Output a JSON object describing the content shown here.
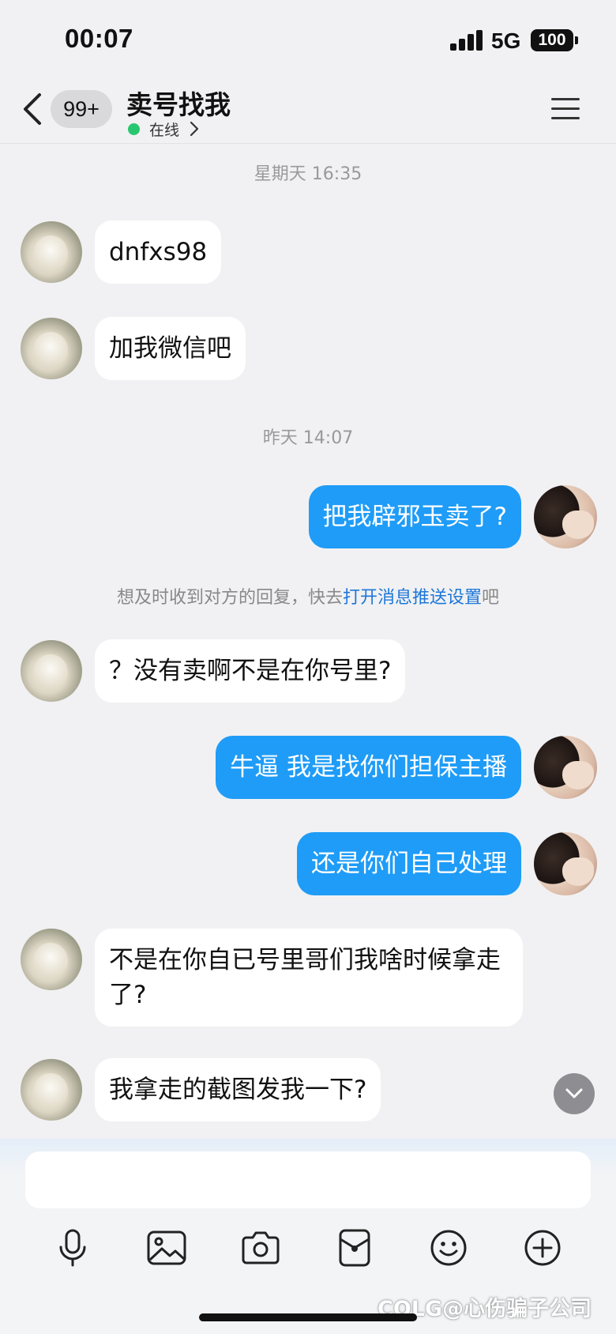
{
  "status_bar": {
    "time": "00:07",
    "network": "5G",
    "battery": "100"
  },
  "header": {
    "unread_badge": "99+",
    "title": "卖号找我",
    "status": "在线"
  },
  "messages": {
    "timestamp_1": "星期天 16:35",
    "m1": "dnfxs98",
    "m2": "加我微信吧",
    "timestamp_2": "昨天 14:07",
    "m3": "把我辟邪玉卖了?",
    "notice_prefix": "想及时收到对方的回复，快去",
    "notice_link": "打开消息推送设置",
    "notice_suffix": "吧",
    "m4": "？没有卖啊不是在你号里?",
    "m5": "牛逼 我是找你们担保主播",
    "m6": "还是你们自己处理",
    "m7": "不是在你自已号里哥们我啥时候拿走了?",
    "m8": "我拿走的截图发我一下?"
  },
  "input": {
    "placeholder": ""
  },
  "toolbar_icons": [
    "microphone-icon",
    "image-icon",
    "camera-icon",
    "red-packet-icon",
    "emoji-icon",
    "plus-icon"
  ],
  "watermark": "COLG@心伤骗子公司",
  "colors": {
    "outgoing_bubble": "#1f9cf7",
    "incoming_bubble": "#ffffff",
    "online": "#28c76f",
    "link": "#1d77d8"
  }
}
